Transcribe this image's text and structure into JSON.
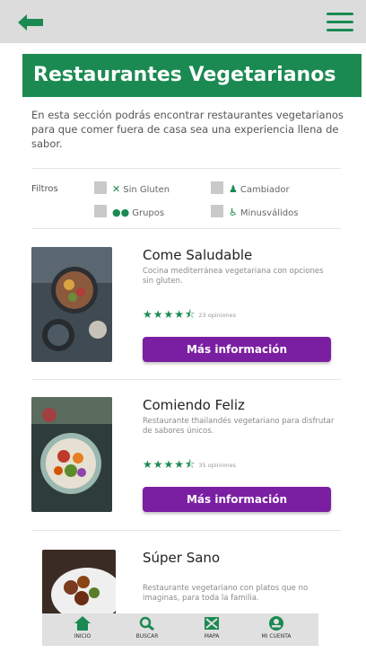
{
  "header": {
    "back_icon": "arrow-left-icon",
    "menu_icon": "hamburger-menu-icon",
    "accent_color": "#1a8a52"
  },
  "page": {
    "title": "Restaurantes Vegetarianos",
    "intro": "En esta sección podrás encontrar restaurantes vegetarianos para que comer fuera de casa sea una experiencia llena de sabor."
  },
  "filters": {
    "label": "Filtros",
    "options": [
      {
        "label": "Sin Gluten",
        "icon": "gluten-free-icon",
        "checked": false
      },
      {
        "label": "Cambiador",
        "icon": "baby-changing-icon",
        "checked": false
      },
      {
        "label": "Grupos",
        "icon": "group-icon",
        "checked": false
      },
      {
        "label": "Minusválidos",
        "icon": "wheelchair-icon",
        "checked": false
      }
    ]
  },
  "restaurants": [
    {
      "name": "Come Saludable",
      "description": "Cocina mediterránea vegetariana con opciones sin gluten.",
      "rating": 4.5,
      "reviews": "23 opiniones",
      "button": "Más información"
    },
    {
      "name": "Comiendo Feliz",
      "description": "Restaurante thailandés vegetariano para disfrutar de sabores únicos.",
      "rating": 4.5,
      "reviews": "35 opiniones",
      "button": "Más información"
    },
    {
      "name": "Súper Sano",
      "description": "Restaurante vegetariano con platos que no imaginas, para toda la familia."
    }
  ],
  "bottom_nav": [
    {
      "label": "INICIO",
      "icon": "home-icon"
    },
    {
      "label": "BUSCAR",
      "icon": "search-icon"
    },
    {
      "label": "MAPA",
      "icon": "map-icon"
    },
    {
      "label": "MI CUENTA",
      "icon": "account-icon"
    }
  ],
  "colors": {
    "primary_green": "#1a8a52",
    "button_purple": "#7b1fa2",
    "topbar_gray": "#dcdcdc"
  }
}
